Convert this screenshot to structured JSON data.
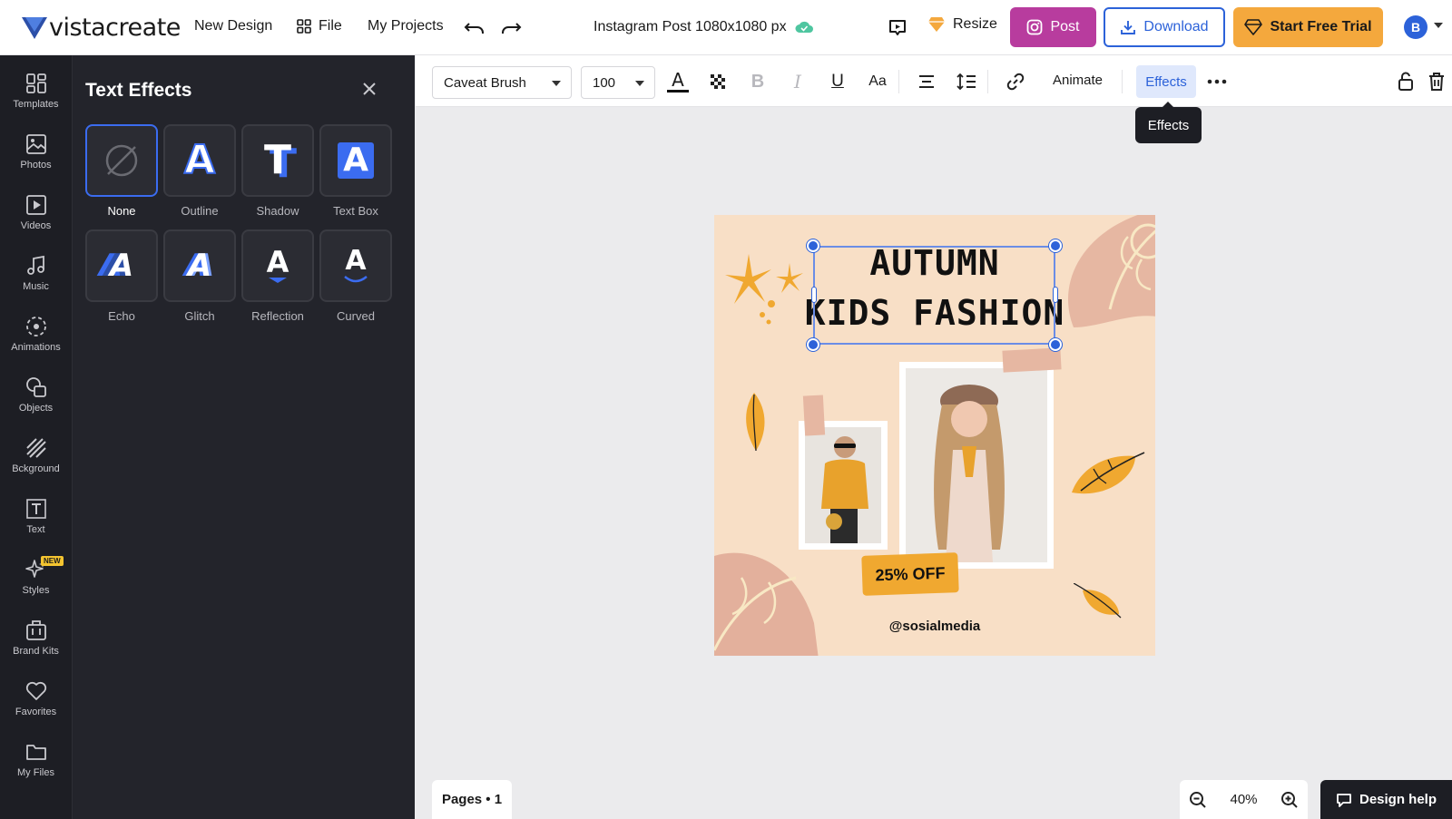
{
  "app": {
    "logo_text": "vistacreate",
    "nav": {
      "new_design": "New Design",
      "file": "File",
      "my_projects": "My Projects"
    },
    "doc_title": "Instagram Post 1080x1080 px",
    "resize_label": "Resize",
    "post_label": "Post",
    "download_label": "Download",
    "trial_label": "Start Free Trial",
    "avatar_initial": "B",
    "colors": {
      "accent": "#2c62d9",
      "post": "#b83c9e",
      "trial": "#f4a83d",
      "rail": "#1d1e24"
    }
  },
  "rail": {
    "items": [
      {
        "label": "Templates",
        "icon": "templates-icon"
      },
      {
        "label": "Photos",
        "icon": "photos-icon"
      },
      {
        "label": "Videos",
        "icon": "videos-icon"
      },
      {
        "label": "Music",
        "icon": "music-icon"
      },
      {
        "label": "Animations",
        "icon": "animations-icon"
      },
      {
        "label": "Objects",
        "icon": "objects-icon"
      },
      {
        "label": "Bckground",
        "icon": "background-icon"
      },
      {
        "label": "Text",
        "icon": "text-icon"
      },
      {
        "label": "Styles",
        "icon": "styles-icon",
        "badge": "NEW"
      },
      {
        "label": "Brand Kits",
        "icon": "brand-kits-icon"
      },
      {
        "label": "Favorites",
        "icon": "heart-icon"
      },
      {
        "label": "My Files",
        "icon": "folder-icon"
      }
    ]
  },
  "panel": {
    "title": "Text Effects",
    "effects": [
      {
        "label": "None",
        "selected": true
      },
      {
        "label": "Outline"
      },
      {
        "label": "Shadow"
      },
      {
        "label": "Text Box"
      },
      {
        "label": "Echo"
      },
      {
        "label": "Glitch"
      },
      {
        "label": "Reflection"
      },
      {
        "label": "Curved"
      }
    ],
    "sample_letter": "A",
    "shadow_letter": "T"
  },
  "toolbar": {
    "font": "Caveat Brush",
    "size": "100",
    "animate_label": "Animate",
    "effects_label": "Effects",
    "tooltip": "Effects",
    "case_label": "Aa",
    "bold_label": "B",
    "italic_label": "I",
    "underline_label": "U",
    "text_color_letter": "A"
  },
  "canvas": {
    "headline_line1": "AUTUMN",
    "headline_line2": "KIDS FASHION",
    "discount": "25% OFF",
    "handle": "@sosialmedia"
  },
  "bottom": {
    "pages_label": "Pages • 1",
    "zoom": "40%",
    "help_label": "Design help"
  }
}
